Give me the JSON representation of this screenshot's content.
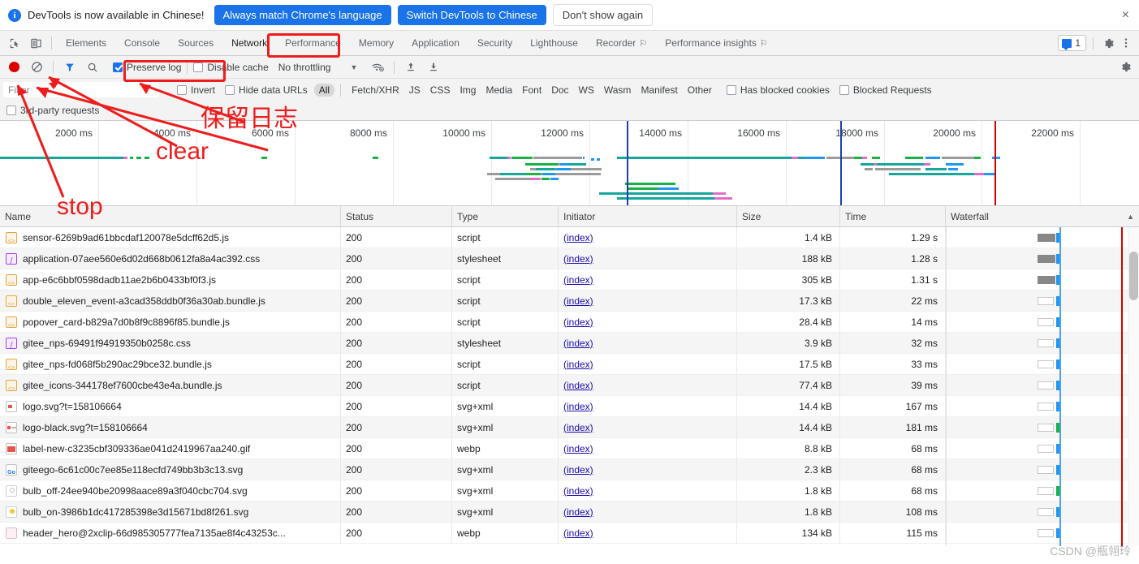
{
  "banner": {
    "info_icon": "info-icon",
    "message": "DevTools is now available in Chinese!",
    "primary_button": "Always match Chrome's language",
    "secondary_button": "Switch DevTools to Chinese",
    "dismiss_button": "Don't show again",
    "close_icon": "×"
  },
  "tabbar": {
    "inspect_icon": "inspect-element-icon",
    "device_icon": "device-toolbar-icon",
    "tabs": [
      {
        "label": "Elements",
        "selected": false,
        "experimental": false
      },
      {
        "label": "Console",
        "selected": false,
        "experimental": false
      },
      {
        "label": "Sources",
        "selected": false,
        "experimental": false
      },
      {
        "label": "Network",
        "selected": true,
        "experimental": false
      },
      {
        "label": "Performance",
        "selected": false,
        "experimental": false
      },
      {
        "label": "Memory",
        "selected": false,
        "experimental": false
      },
      {
        "label": "Application",
        "selected": false,
        "experimental": false
      },
      {
        "label": "Security",
        "selected": false,
        "experimental": false
      },
      {
        "label": "Lighthouse",
        "selected": false,
        "experimental": false
      },
      {
        "label": "Recorder",
        "selected": false,
        "experimental": true
      },
      {
        "label": "Performance insights",
        "selected": false,
        "experimental": true
      }
    ],
    "issues_count": "1",
    "settings_icon": "gear-icon",
    "more_icon": "kebab-menu-icon"
  },
  "network_toolbar": {
    "record_icon": "record-button",
    "clear_icon": "clear-button",
    "filter_icon": "filter-funnel-icon",
    "search_icon": "search-icon",
    "preserve_log_label": "Preserve log",
    "preserve_log_checked": true,
    "disable_cache_label": "Disable cache",
    "disable_cache_checked": false,
    "throttling_value": "No throttling",
    "throttle_caret": "▼",
    "wifi_icon": "network-conditions-icon",
    "import_icon": "import-har-icon",
    "export_icon": "export-har-icon",
    "settings_icon": "network-settings-gear-icon"
  },
  "filter_row": {
    "placeholder": "Filter",
    "value": "",
    "invert_label": "Invert",
    "invert_checked": false,
    "hide_data_urls_label": "Hide data URLs",
    "hide_data_urls_checked": false,
    "types": [
      "All",
      "Fetch/XHR",
      "JS",
      "CSS",
      "Img",
      "Media",
      "Font",
      "Doc",
      "WS",
      "Wasm",
      "Manifest",
      "Other"
    ],
    "active_type": "All",
    "has_blocked_cookies_label": "Has blocked cookies",
    "has_blocked_cookies_checked": false,
    "blocked_requests_label": "Blocked Requests",
    "blocked_requests_checked": false,
    "third_party_label": "3rd-party requests",
    "third_party_checked": false
  },
  "overview": {
    "ticks": [
      "2000 ms",
      "4000 ms",
      "6000 ms",
      "8000 ms",
      "10000 ms",
      "12000 ms",
      "14000 ms",
      "16000 ms",
      "18000 ms",
      "20000 ms",
      "22000 ms"
    ],
    "tick_interval_ms": 2000,
    "dom_content_loaded_color": "#1a3fb0",
    "load_event_color": "#d40000"
  },
  "table": {
    "columns": [
      "Name",
      "Status",
      "Type",
      "Initiator",
      "Size",
      "Time",
      "Waterfall"
    ],
    "sort_indicator": "▲",
    "rows": [
      {
        "name": "sensor-6269b9ad61bbcdaf120078e5dcff62d5.js",
        "icon": "js",
        "status": "200",
        "type": "script",
        "initiator": "(index)",
        "size": "1.4 kB",
        "time": "1.29 s"
      },
      {
        "name": "application-07aee560e6d02d668b0612fa8a4ac392.css",
        "icon": "css",
        "status": "200",
        "type": "stylesheet",
        "initiator": "(index)",
        "size": "188 kB",
        "time": "1.28 s"
      },
      {
        "name": "app-e6c6bbf0598dadb11ae2b6b0433bf0f3.js",
        "icon": "js",
        "status": "200",
        "type": "script",
        "initiator": "(index)",
        "size": "305 kB",
        "time": "1.31 s"
      },
      {
        "name": "double_eleven_event-a3cad358ddb0f36a30ab.bundle.js",
        "icon": "js",
        "status": "200",
        "type": "script",
        "initiator": "(index)",
        "size": "17.3 kB",
        "time": "22 ms"
      },
      {
        "name": "popover_card-b829a7d0b8f9c8896f85.bundle.js",
        "icon": "js",
        "status": "200",
        "type": "script",
        "initiator": "(index)",
        "size": "28.4 kB",
        "time": "14 ms"
      },
      {
        "name": "gitee_nps-69491f94919350b0258c.css",
        "icon": "css",
        "status": "200",
        "type": "stylesheet",
        "initiator": "(index)",
        "size": "3.9 kB",
        "time": "32 ms"
      },
      {
        "name": "gitee_nps-fd068f5b290ac29bce32.bundle.js",
        "icon": "js",
        "status": "200",
        "type": "script",
        "initiator": "(index)",
        "size": "17.5 kB",
        "time": "33 ms"
      },
      {
        "name": "gitee_icons-344178ef7600cbe43e4a.bundle.js",
        "icon": "js",
        "status": "200",
        "type": "script",
        "initiator": "(index)",
        "size": "77.4 kB",
        "time": "39 ms"
      },
      {
        "name": "logo.svg?t=158106664",
        "icon": "img",
        "status": "200",
        "type": "svg+xml",
        "initiator": "(index)",
        "size": "14.4 kB",
        "time": "167 ms"
      },
      {
        "name": "logo-black.svg?t=158106664",
        "icon": "img2",
        "status": "200",
        "type": "svg+xml",
        "initiator": "(index)",
        "size": "14.4 kB",
        "time": "181 ms"
      },
      {
        "name": "label-new-c3235cbf309336ae041d2419967aa240.gif",
        "icon": "gif",
        "status": "200",
        "type": "webp",
        "initiator": "(index)",
        "size": "8.8 kB",
        "time": "68 ms"
      },
      {
        "name": "giteego-6c61c00c7ee85e118ecfd749bb3b3c13.svg",
        "icon": "go",
        "status": "200",
        "type": "svg+xml",
        "initiator": "(index)",
        "size": "2.3 kB",
        "time": "68 ms"
      },
      {
        "name": "bulb_off-24ee940be20998aace89a3f040cbc704.svg",
        "icon": "bulb",
        "status": "200",
        "type": "svg+xml",
        "initiator": "(index)",
        "size": "1.8 kB",
        "time": "68 ms"
      },
      {
        "name": "bulb_on-3986b1dc417285398e3d15671bd8f261.svg",
        "icon": "bulbon",
        "status": "200",
        "type": "svg+xml",
        "initiator": "(index)",
        "size": "1.8 kB",
        "time": "108 ms"
      },
      {
        "name": "header_hero@2xclip-66d985305777fea7135ae8f4c43253c...",
        "icon": "webp",
        "status": "200",
        "type": "webp",
        "initiator": "(index)",
        "size": "134 kB",
        "time": "115 ms"
      }
    ]
  },
  "annotations": {
    "preserve_log_cn": "保留日志",
    "clear_label": "clear",
    "stop_label": "stop",
    "network_highlight": "Network",
    "preserve_log_highlight": "Preserve log"
  },
  "watermark": {
    "text": "CSDN @瓶翎玲"
  }
}
